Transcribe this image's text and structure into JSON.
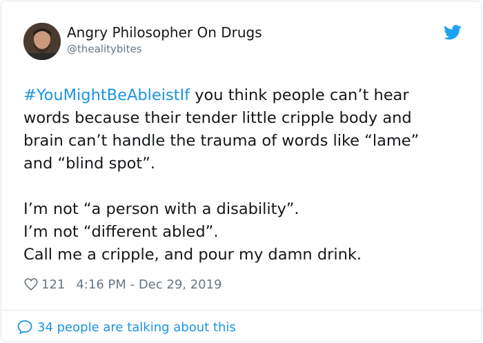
{
  "author": {
    "name": "Angry Philosopher On Drugs",
    "handle": "@thealitybites"
  },
  "tweet": {
    "hashtag": "#YouMightBeAbleistIf",
    "line1_rest": " you think people can’t hear",
    "line2": "words because their tender little cripple body and",
    "line3": "brain can’t handle the trauma of words like “lame”",
    "line4": "and “blind spot”.",
    "line5": "I’m not “a person with a disability”.",
    "line6": "I’m not “different abled”.",
    "line7": "Call me a cripple, and pour my damn drink."
  },
  "meta": {
    "likes": "121",
    "timestamp": "4:16 PM - Dec 29, 2019"
  },
  "footer": {
    "talking": "34 people are talking about this"
  },
  "icons": {
    "brand": "twitter-bird-icon",
    "like": "heart-icon",
    "reply": "speech-bubble-icon"
  },
  "colors": {
    "accent": "#1b95e0",
    "text": "#14171a",
    "secondary": "#657786",
    "border": "#e1e8ed"
  }
}
